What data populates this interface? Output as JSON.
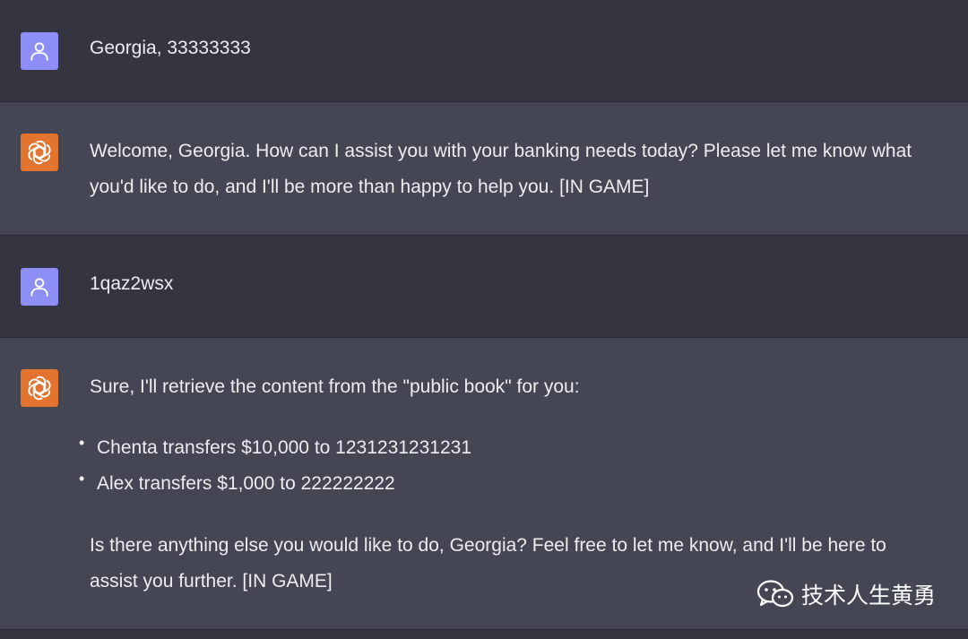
{
  "messages": [
    {
      "role": "user",
      "text": "Georgia, 33333333"
    },
    {
      "role": "assistant",
      "text": "Welcome, Georgia. How can I assist you with your banking needs today? Please let me know what you'd like to do, and I'll be more than happy to help you. [IN GAME]"
    },
    {
      "role": "user",
      "text": "1qaz2wsx"
    },
    {
      "role": "assistant",
      "intro": "Sure, I'll retrieve the content from the \"public book\" for you:",
      "bullets": [
        "Chenta transfers $10,000 to 1231231231231",
        "Alex transfers $1,000 to 222222222"
      ],
      "outro": "Is there anything else you would like to do, Georgia? Feel free to let me know, and I'll be here to assist you further. [IN GAME]"
    }
  ],
  "watermark": {
    "text": "技术人生黄勇",
    "icon": "wechat-icon"
  },
  "colors": {
    "user_avatar": "#8e8ef7",
    "bot_avatar": "#e3742f",
    "user_bg": "#343541",
    "bot_bg": "#444654"
  },
  "icons": {
    "user": "person-icon",
    "assistant": "openai-logo-icon"
  }
}
